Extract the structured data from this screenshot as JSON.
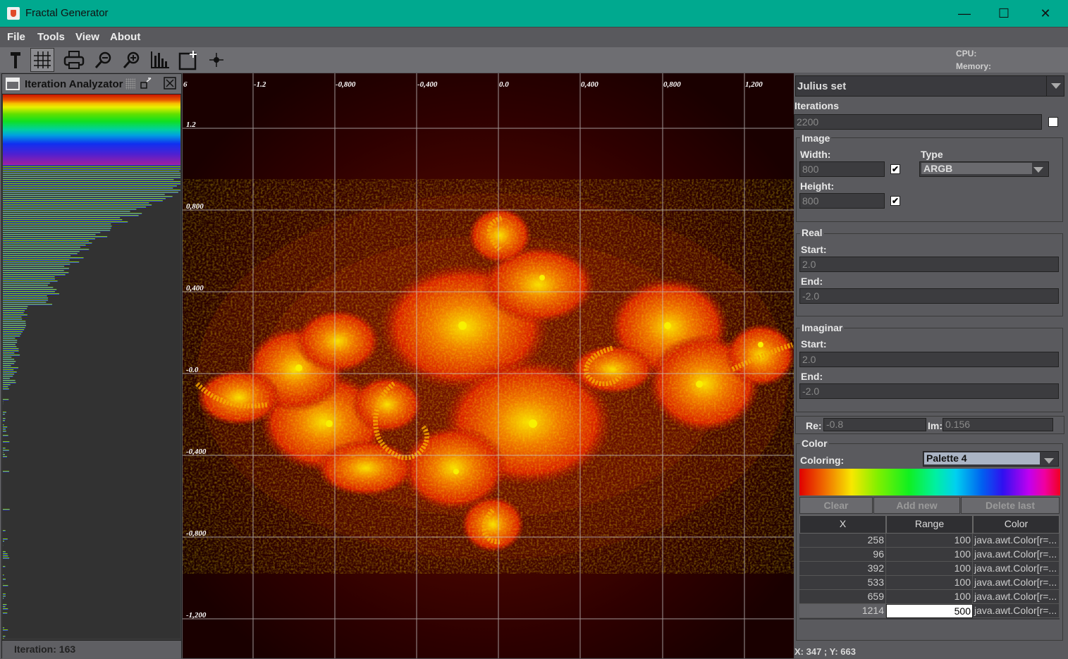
{
  "window": {
    "title": "Fractal Generator",
    "minimize": "—",
    "maximize": "☐",
    "close": "✕"
  },
  "menu": [
    "File",
    "Tools",
    "View",
    "About"
  ],
  "toolbar": {
    "icons": [
      "hammer-icon",
      "grid-icon",
      "printer-icon",
      "zoom-out-icon",
      "zoom-in-icon",
      "histogram-icon",
      "new-window-icon",
      "crosshair-icon"
    ],
    "cpu_label": "CPU:",
    "memory_label": "Memory:"
  },
  "analyzer": {
    "title": "Iteration Analyzator",
    "iteration_label": "Iteration:  163"
  },
  "axes": {
    "x_ticks": [
      "6",
      "-1.2",
      "-0,800",
      "-0,400",
      "0.0",
      "0,400",
      "0,800",
      "1,200"
    ],
    "y_ticks": [
      "1.2",
      "0,800",
      "0,400",
      "-0.0",
      "-0,400",
      "-0,800",
      "-1,200"
    ]
  },
  "panel": {
    "fractal_type": "Julius set",
    "iterations_label": "Iterations",
    "iterations_value": "2200",
    "image_group": "Image",
    "width_label": "Width:",
    "width_value": "800",
    "height_label": "Height:",
    "height_value": "800",
    "type_label": "Type",
    "type_value": "ARGB",
    "real_group": "Real",
    "real_start_label": "Start:",
    "real_start": "2.0",
    "real_end_label": "End:",
    "real_end": "-2.0",
    "imag_group": "Imaginar",
    "imag_start_label": "Start:",
    "imag_start": "2.0",
    "imag_end_label": "End:",
    "imag_end": "-2.0",
    "re_label": "Re:",
    "re_value": "-0.8",
    "im_label": "Im:",
    "im_value": "0.156",
    "color_group": "Color",
    "coloring_label": "Coloring:",
    "coloring_value": "Palette 4",
    "clear_btn": "Clear",
    "add_btn": "Add new",
    "delete_btn": "Delete last",
    "columns": [
      "X",
      "Range",
      "Color"
    ],
    "rows": [
      {
        "x": "258",
        "range": "100",
        "color": "java.awt.Color[r=..."
      },
      {
        "x": "96",
        "range": "100",
        "color": "java.awt.Color[r=..."
      },
      {
        "x": "392",
        "range": "100",
        "color": "java.awt.Color[r=..."
      },
      {
        "x": "533",
        "range": "100",
        "color": "java.awt.Color[r=..."
      },
      {
        "x": "659",
        "range": "100",
        "color": "java.awt.Color[r=..."
      },
      {
        "x": "1214",
        "range": "500",
        "color": "java.awt.Color[r=..."
      }
    ],
    "coords": "X: 347 ; Y: 663"
  },
  "colors": {
    "titlebar": "#00a98f",
    "panel": "#5a5a5e",
    "fractal_bg": "#2a0000"
  }
}
